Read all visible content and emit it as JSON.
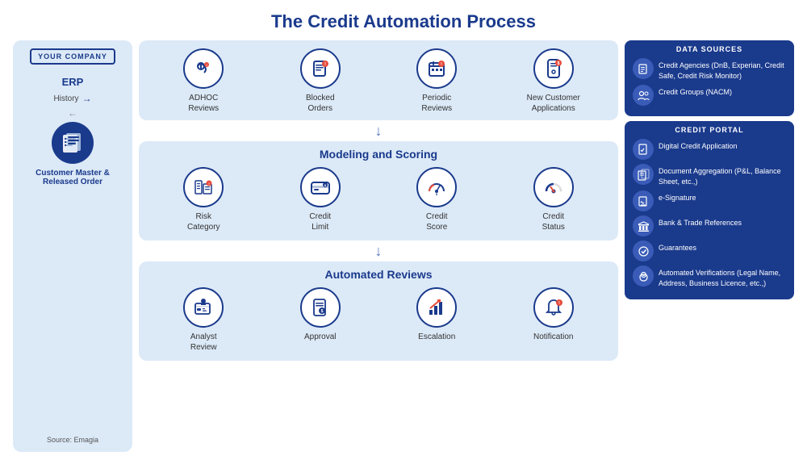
{
  "title": "The Credit Automation Process",
  "left_panel": {
    "title": "YOUR COMPANY",
    "erp": "ERP",
    "history": "History",
    "customer_master": "Customer Master\n& Released Order",
    "source": "Source: Emagia"
  },
  "center_top": {
    "items": [
      {
        "label": "ADHOC\nReviews"
      },
      {
        "label": "Blocked\nOrders"
      },
      {
        "label": "Periodic\nReviews"
      },
      {
        "label": "New Customer\nApplications"
      }
    ]
  },
  "modeling": {
    "title": "Modeling and Scoring",
    "items": [
      {
        "label": "Risk\nCategory"
      },
      {
        "label": "Credit\nLimit"
      },
      {
        "label": "Credit\nScore"
      },
      {
        "label": "Credit\nStatus"
      }
    ]
  },
  "automated": {
    "title": "Automated Reviews",
    "items": [
      {
        "label": "Analyst\nReview"
      },
      {
        "label": "Approval"
      },
      {
        "label": "Escalation"
      },
      {
        "label": "Notification"
      }
    ]
  },
  "data_sources": {
    "title": "DATA SOURCES",
    "items": [
      {
        "text": "Credit Agencies\n(DnB, Experian, Credit Safe,\nCredit Risk Monitor)"
      },
      {
        "text": "Credit Groups (NACM)"
      }
    ]
  },
  "credit_portal": {
    "title": "CREDIT PORTAL",
    "items": [
      {
        "text": "Digital Credit Application"
      },
      {
        "text": "Document Aggregation\n(P&L, Balance Sheet, etc.,)"
      },
      {
        "text": "e-Signature"
      },
      {
        "text": "Bank & Trade References"
      },
      {
        "text": "Guarantees"
      },
      {
        "text": "Automated Verifications\n(Legal Name, Address,\nBusiness Licence, etc.,)"
      }
    ]
  }
}
